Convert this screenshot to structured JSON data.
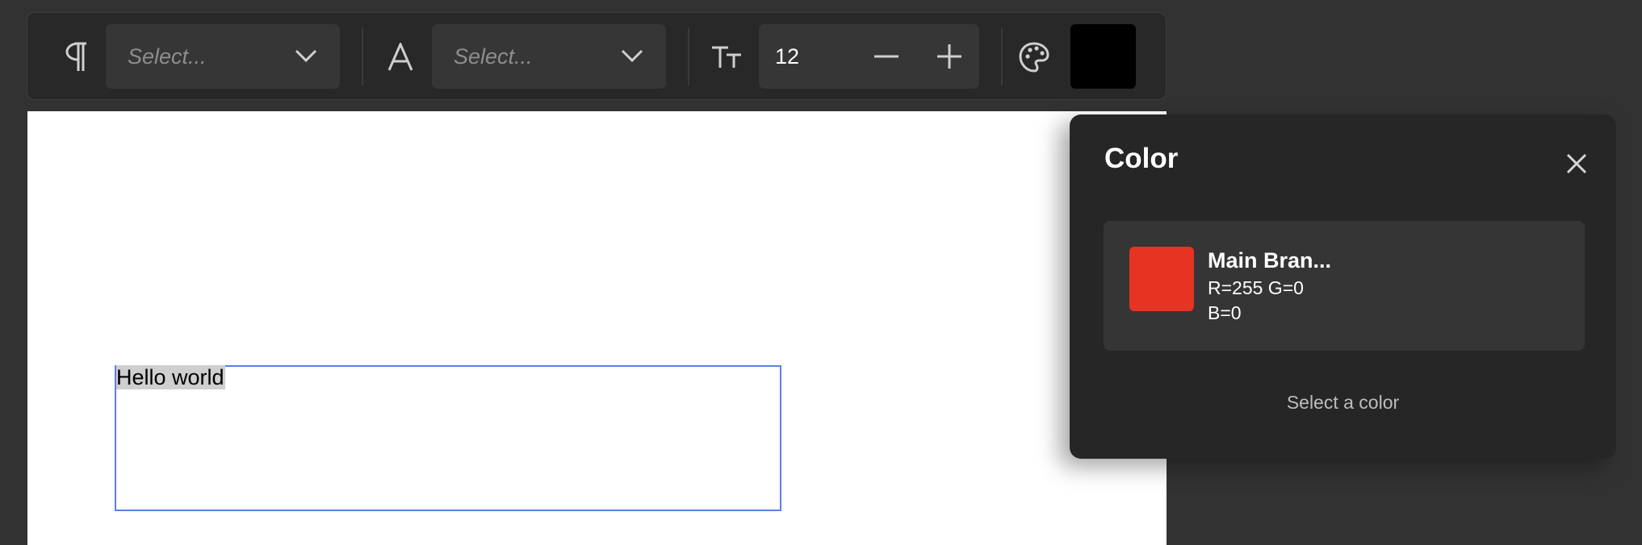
{
  "toolbar": {
    "paragraph_style": {
      "placeholder": "Select...",
      "icon": "paragraph-icon"
    },
    "font_family": {
      "placeholder": "Select...",
      "icon": "font-icon"
    },
    "font_size": {
      "value": "12",
      "icon": "text-size-icon"
    },
    "color": {
      "icon": "palette-icon",
      "current": "#000000"
    }
  },
  "canvas": {
    "text_box": {
      "text": "Hello world"
    }
  },
  "color_popover": {
    "title": "Color",
    "swatch": {
      "name": "Main Bran...",
      "values_line1": "R=255 G=0",
      "values_line2": "B=0",
      "color": "#e73322"
    },
    "select_label": "Select a color"
  }
}
